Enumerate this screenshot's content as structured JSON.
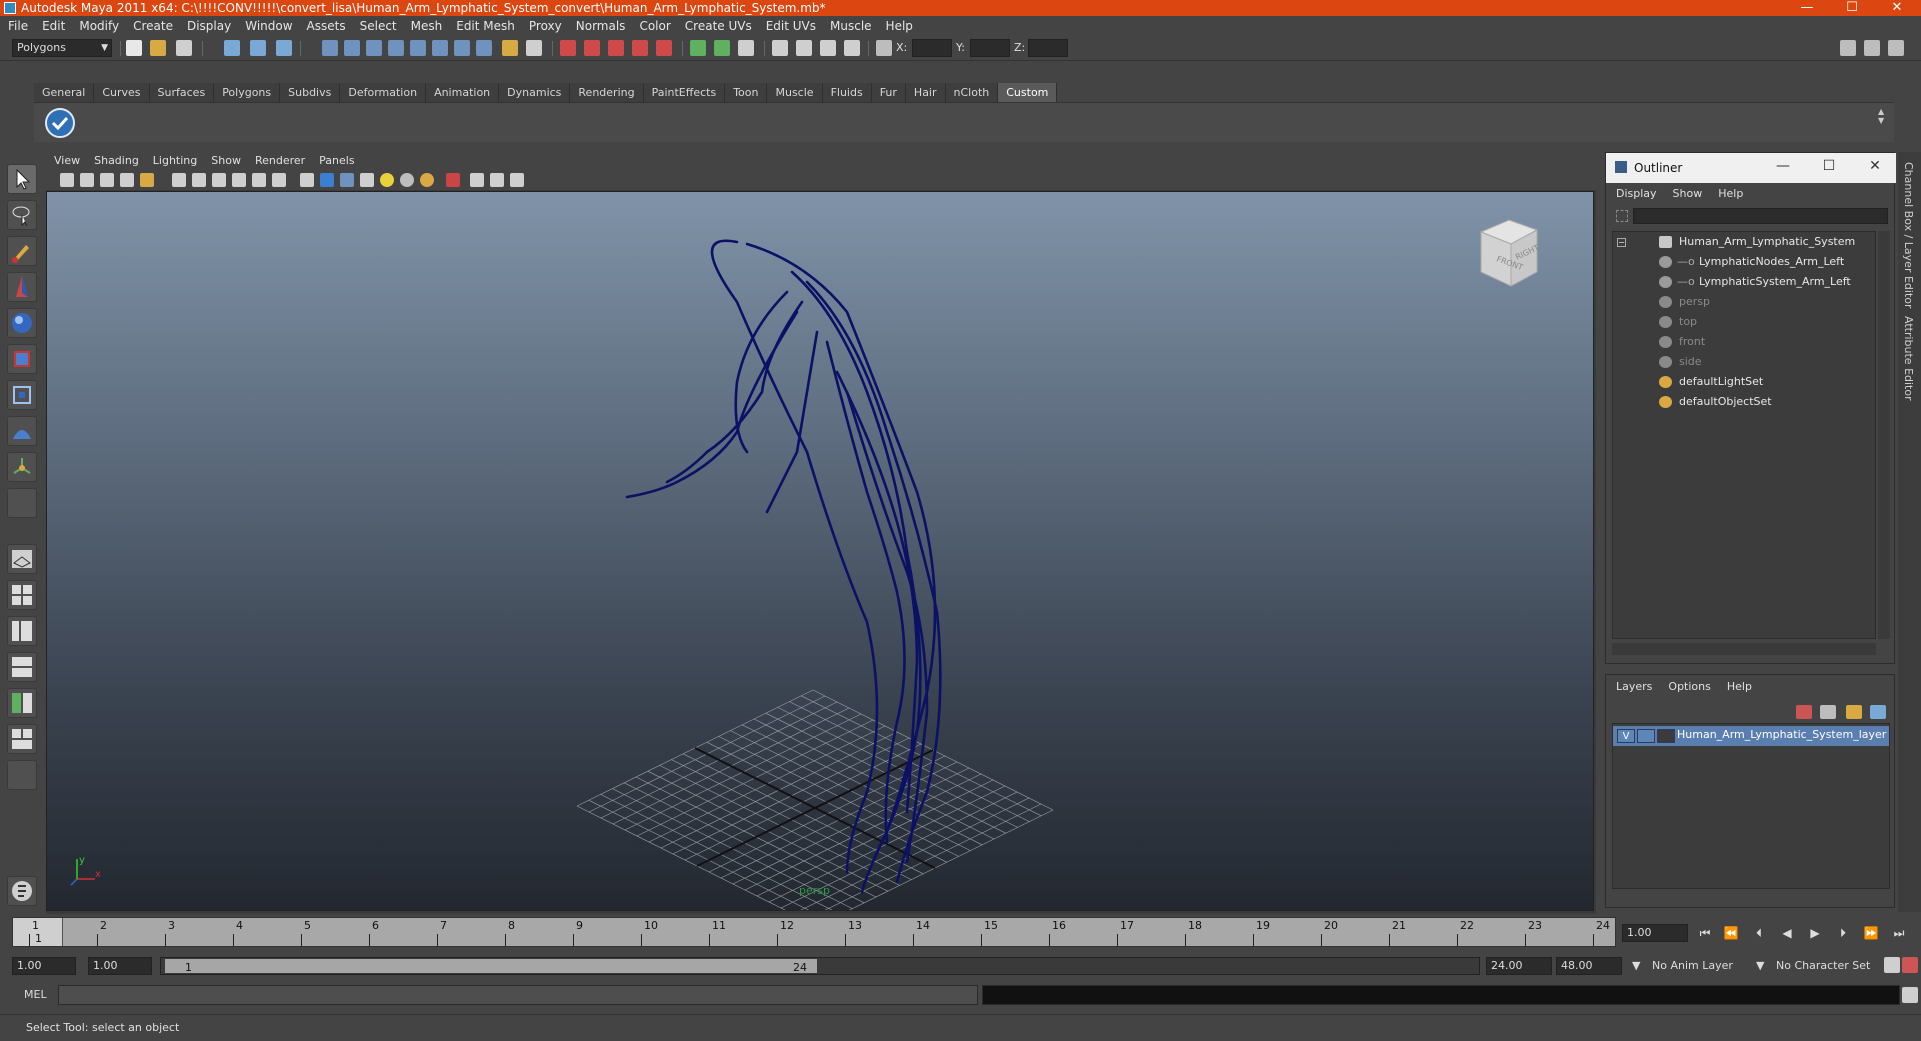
{
  "window": {
    "title": "Autodesk Maya 2011 x64: C:\\!!!!CONV!!!!!\\convert_lisa\\Human_Arm_Lymphatic_System_convert\\Human_Arm_Lymphatic_System.mb*",
    "minimize": "—",
    "maximize": "☐",
    "close": "✕"
  },
  "menu": [
    "File",
    "Edit",
    "Modify",
    "Create",
    "Display",
    "Window",
    "Assets",
    "Select",
    "Mesh",
    "Edit Mesh",
    "Proxy",
    "Normals",
    "Color",
    "Create UVs",
    "Edit UVs",
    "Muscle",
    "Help"
  ],
  "statusline": {
    "mode": "Polygons",
    "x_label": "X:",
    "y_label": "Y:",
    "z_label": "Z:"
  },
  "shelf_tabs": [
    "General",
    "Curves",
    "Surfaces",
    "Polygons",
    "Subdivs",
    "Deformation",
    "Animation",
    "Dynamics",
    "Rendering",
    "PaintEffects",
    "Toon",
    "Muscle",
    "Fluids",
    "Fur",
    "Hair",
    "nCloth",
    "Custom"
  ],
  "shelf_active": "Custom",
  "viewport": {
    "menu": [
      "View",
      "Shading",
      "Lighting",
      "Show",
      "Renderer",
      "Panels"
    ],
    "camera": "persp",
    "viewcube_front": "FRONT",
    "viewcube_right": "RIGHT",
    "axis_y": "y",
    "axis_x": "x",
    "object_color": "#0c1166"
  },
  "outliner": {
    "title": "Outliner",
    "menu": [
      "Display",
      "Show",
      "Help"
    ],
    "items": [
      {
        "label": "Human_Arm_Lymphatic_System",
        "indent": 0,
        "dim": false
      },
      {
        "label": "LymphaticNodes_Arm_Left",
        "indent": 1,
        "dim": false
      },
      {
        "label": "LymphaticSystem_Arm_Left",
        "indent": 1,
        "dim": false
      },
      {
        "label": "persp",
        "indent": 0,
        "dim": true
      },
      {
        "label": "top",
        "indent": 0,
        "dim": true
      },
      {
        "label": "front",
        "indent": 0,
        "dim": true
      },
      {
        "label": "side",
        "indent": 0,
        "dim": true
      },
      {
        "label": "defaultLightSet",
        "indent": 0,
        "dim": false
      },
      {
        "label": "defaultObjectSet",
        "indent": 0,
        "dim": false
      }
    ]
  },
  "layers": {
    "menu": [
      "Layers",
      "Options",
      "Help"
    ],
    "visibility": "V",
    "layer_name": "Human_Arm_Lymphatic_System_layer",
    "layer_color": "#5a7eaf"
  },
  "side_tabs": [
    "Channel Box / Layer Editor",
    "Attribute Editor"
  ],
  "timeline": {
    "ticks": [
      "1",
      "2",
      "3",
      "4",
      "5",
      "6",
      "7",
      "8",
      "9",
      "10",
      "11",
      "12",
      "13",
      "14",
      "15",
      "16",
      "17",
      "18",
      "19",
      "20",
      "21",
      "22",
      "23",
      "24"
    ],
    "current_frame": "1",
    "current_frame_field": "1.00"
  },
  "range": {
    "start": "1.00",
    "playback_start": "1.00",
    "range_start_label": "1",
    "range_end_label": "24",
    "playback_end": "24.00",
    "end": "48.00",
    "anim_layer": "No Anim Layer",
    "character_set": "No Character Set"
  },
  "command": {
    "language": "MEL"
  },
  "help_line": "Select Tool: select an object"
}
